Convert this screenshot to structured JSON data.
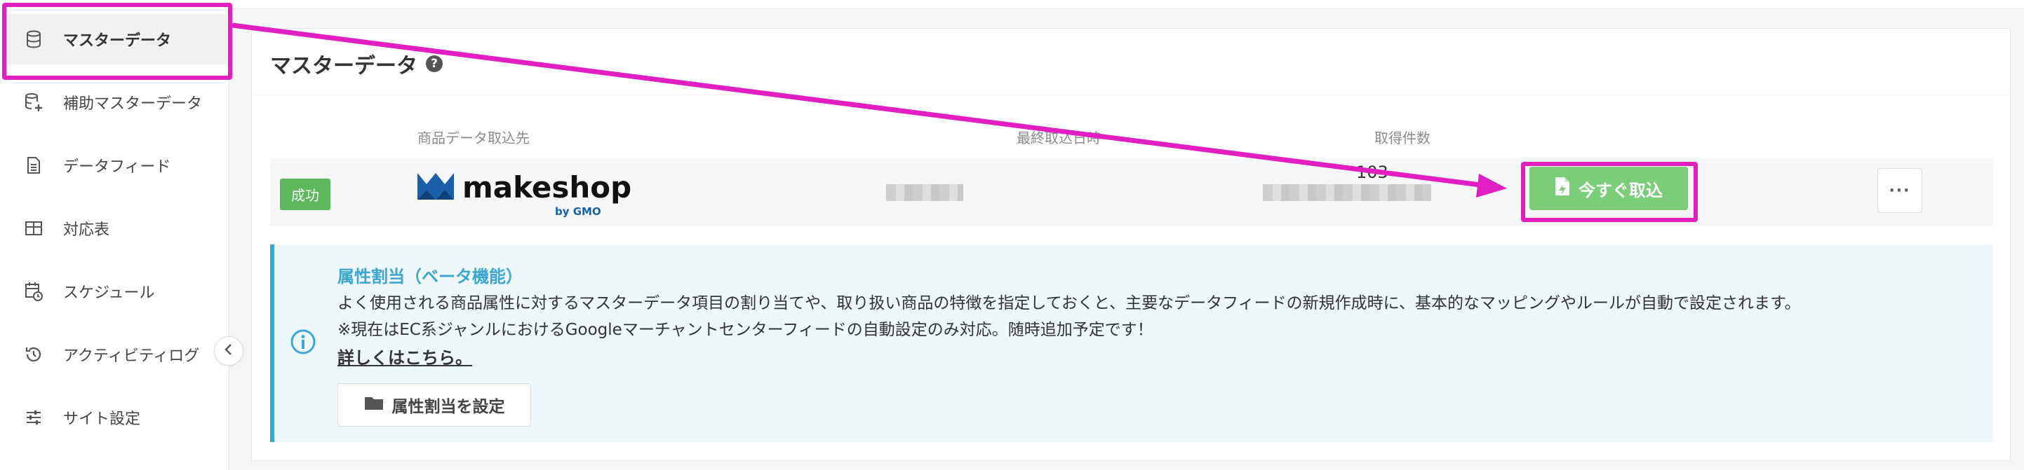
{
  "sidebar": {
    "items": [
      {
        "label": "マスターデータ",
        "icon": "database-icon",
        "active": true
      },
      {
        "label": "補助マスターデータ",
        "icon": "database-plus-icon"
      },
      {
        "label": "データフィード",
        "icon": "document-icon"
      },
      {
        "label": "対応表",
        "icon": "table-icon"
      },
      {
        "label": "スケジュール",
        "icon": "calendar-clock-icon"
      },
      {
        "label": "アクティビティログ",
        "icon": "history-icon"
      },
      {
        "label": "サイト設定",
        "icon": "sliders-icon"
      }
    ]
  },
  "main": {
    "title": "マスターデータ",
    "columns": {
      "source": "商品データ取込先",
      "last_import": "最終取込日時",
      "count": "取得件数"
    },
    "row": {
      "status": "成功",
      "logo_brand": "makeshop",
      "logo_sub": "by GMO",
      "count": "103",
      "import_button": "今すぐ取込",
      "more_button": "···"
    },
    "info": {
      "title": "属性割当（ベータ機能）",
      "line1": "よく使用される商品属性に対するマスターデータ項目の割り当てや、取り扱い商品の特徴を指定しておくと、主要なデータフィードの新規作成時に、基本的なマッピングやルールが自動で設定されます。",
      "line2": "※現在はEC系ジャンルにおけるGoogleマーチャントセンターフィードの自動設定のみ対応。随時追加予定です！",
      "link": "詳しくはこちら。",
      "button": "属性割当を設定"
    }
  },
  "colors": {
    "accent_highlight": "#e01ec2",
    "success": "#5cb85c",
    "import_button": "#7ccd79",
    "info_accent": "#3ba6cf"
  }
}
